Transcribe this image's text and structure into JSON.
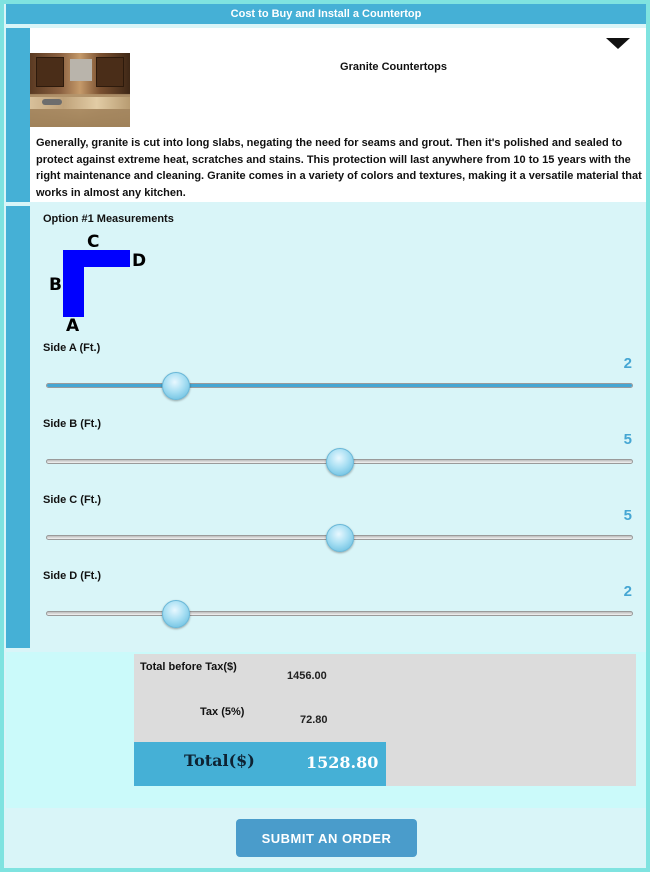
{
  "header": {
    "title": "Cost to Buy and Install a Countertop"
  },
  "product": {
    "title": "Granite Countertops",
    "description": "Generally, granite is cut into long slabs, negating the need for seams and grout. Then it's polished and sealed to protect against extreme heat, scratches and stains. This protection will last anywhere from 10 to 15 years with the right maintenance and cleaning. Granite comes in a variety of colors and textures, making it a versatile material that works in almost any kitchen.",
    "expand_icon": "caret-down-icon"
  },
  "measurements": {
    "title": "Option #1 Measurements",
    "shape_labels": {
      "a": "A",
      "b": "B",
      "c": "C",
      "d": "D"
    },
    "shape_color": "#0000ff",
    "sides": [
      {
        "label": "Side A (Ft.)",
        "value": "2",
        "fraction": 0.22
      },
      {
        "label": "Side B (Ft.)",
        "value": "5",
        "fraction": 0.5
      },
      {
        "label": "Side C (Ft.)",
        "value": "5",
        "fraction": 0.5
      },
      {
        "label": "Side D (Ft.)",
        "value": "2",
        "fraction": 0.22
      }
    ]
  },
  "totals": {
    "before_tax_label": "Total before Tax($)",
    "before_tax_value": "1456.00",
    "tax_label": "Tax (5%)",
    "tax_value": "72.80",
    "total_label": "Total($)",
    "total_value": "1528.80"
  },
  "actions": {
    "submit_label": "SUBMIT AN ORDER"
  },
  "colors": {
    "accent": "#45b0d6",
    "button": "#4a9ccb",
    "panel": "#d9f5f8",
    "page": "#7fe3e0"
  }
}
